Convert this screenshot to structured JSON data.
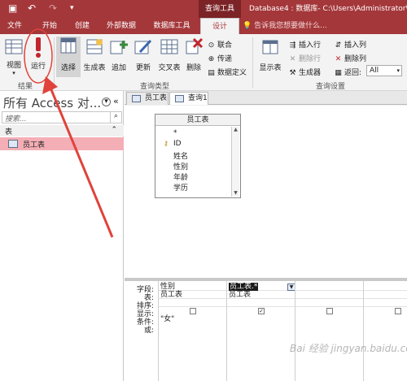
{
  "titlebar": {
    "context_tools": "查询工具",
    "doc_title": "Database4 : 数据库- C:\\Users\\Administrator\\Doc",
    "quick_access": {
      "save": "▣",
      "undo": "↶",
      "redo": "↷",
      "more": "▾"
    }
  },
  "tabs": [
    {
      "label": "文件"
    },
    {
      "label": "开始"
    },
    {
      "label": "创建"
    },
    {
      "label": "外部数据"
    },
    {
      "label": "数据库工具"
    },
    {
      "label": "设计"
    }
  ],
  "tellme": "告诉我您想要做什么...",
  "ribbon": {
    "results": {
      "view": "视图",
      "run": "运行",
      "group": "结果"
    },
    "query_type": {
      "select": "选择",
      "make_table": "生成表",
      "append": "追加",
      "update": "更新",
      "crosstab": "交叉表",
      "delete": "删除",
      "union": "联合",
      "pass_through": "传递",
      "data_definition": "数据定义",
      "group": "查询类型"
    },
    "query_setup": {
      "show_table": "显示表",
      "insert_rows": "插入行",
      "delete_rows": "删除行",
      "builder": "生成器",
      "insert_columns": "插入列",
      "delete_columns": "删除列",
      "return_label": "返回:",
      "return_value": "All",
      "group": "查询设置"
    }
  },
  "nav": {
    "title": "所有 Access 对...",
    "search_placeholder": "搜索...",
    "category": "表",
    "items": [
      {
        "label": "员工表"
      }
    ]
  },
  "doc_tabs": [
    {
      "label": "员工表"
    },
    {
      "label": "查询1"
    }
  ],
  "table_box": {
    "title": "员工表",
    "fields": [
      "*",
      "ID",
      "姓名",
      "性别",
      "年龄",
      "学历"
    ]
  },
  "grid": {
    "row_labels": [
      "字段:",
      "表:",
      "排序:",
      "显示:",
      "条件:",
      "或:"
    ],
    "columns": [
      {
        "field": "性别",
        "table": "员工表",
        "sort": "",
        "show": false,
        "criteria": "\"女\""
      },
      {
        "field": "员工表.*",
        "table": "员工表",
        "sort": "",
        "show": true,
        "criteria": ""
      },
      {
        "field": "",
        "table": "",
        "sort": "",
        "show": false,
        "criteria": ""
      },
      {
        "field": "",
        "table": "",
        "sort": "",
        "show": false,
        "criteria": ""
      }
    ]
  },
  "watermark": "Bai 经验 jingyan.baidu.com"
}
